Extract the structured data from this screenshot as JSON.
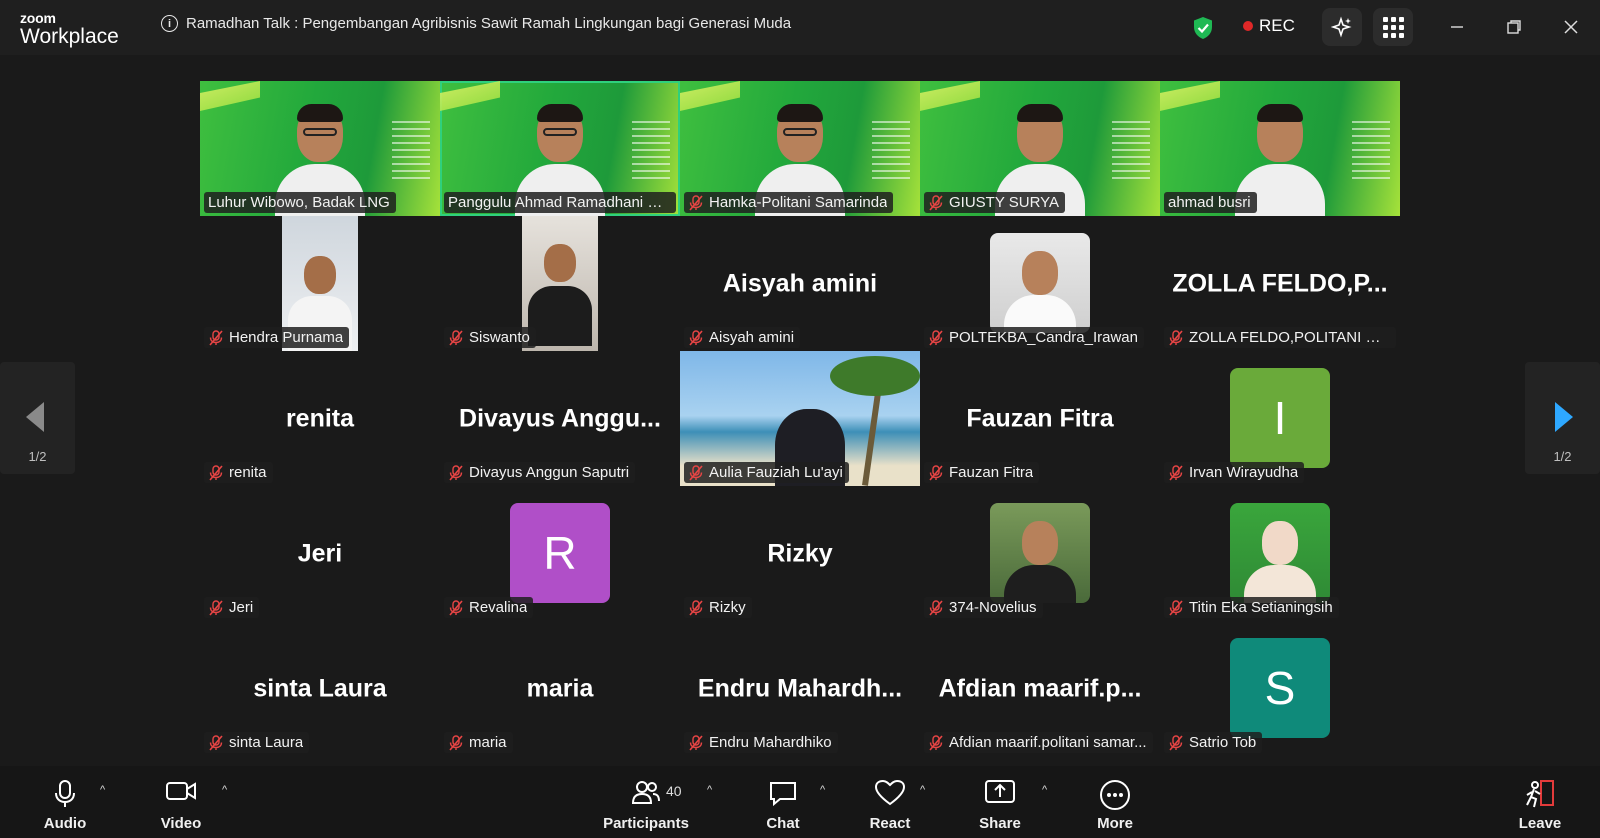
{
  "app": {
    "brand_top": "zoom",
    "brand_bottom": "Workplace"
  },
  "meeting": {
    "title": "Ramadhan Talk : Pengembangan Agribisnis Sawit Ramah Lingkungan bagi Generasi Muda",
    "rec_label": "REC"
  },
  "colors": {
    "active_speaker": "#2fd07d",
    "rec_dot": "#e02828",
    "security_shield": "#1fb954",
    "nav_arrow_right": "#2ea8ff"
  },
  "tiles": [
    {
      "name": "Luhur Wibowo, Badak LNG",
      "display": "",
      "kind": "video",
      "muted": false
    },
    {
      "name": "Panggulu Ahmad Ramadhani U...",
      "display": "",
      "kind": "video",
      "muted": false,
      "active": true
    },
    {
      "name": "Hamka-Politani Samarinda",
      "display": "",
      "kind": "video",
      "muted": true
    },
    {
      "name": "GIUSTY SURYA",
      "display": "",
      "kind": "video",
      "muted": true
    },
    {
      "name": "ahmad busri",
      "display": "",
      "kind": "video",
      "muted": false
    },
    {
      "name": "Hendra Purnama",
      "display": "",
      "kind": "photo-tall",
      "muted": true
    },
    {
      "name": "Siswanto",
      "display": "",
      "kind": "photo-tall",
      "muted": true
    },
    {
      "name": "Aisyah amini",
      "display": "Aisyah amini",
      "kind": "text",
      "muted": true
    },
    {
      "name": "POLTEKBA_Candra_Irawan",
      "display": "",
      "kind": "photo",
      "muted": true
    },
    {
      "name": "ZOLLA FELDO,POLITANI SA...",
      "display": "ZOLLA  FELDO,P...",
      "kind": "text",
      "muted": true
    },
    {
      "name": "renita",
      "display": "renita",
      "kind": "text",
      "muted": true
    },
    {
      "name": "Divayus Anggun Saputri",
      "display": "Divayus  Anggu...",
      "kind": "text",
      "muted": true
    },
    {
      "name": "Aulia Fauziah Lu'ayi",
      "display": "",
      "kind": "beach",
      "muted": true
    },
    {
      "name": "Fauzan Fitra",
      "display": "Fauzan Fitra",
      "kind": "text",
      "muted": true
    },
    {
      "name": "Irvan Wirayudha",
      "display": "I",
      "kind": "avatar",
      "avatar_color": "#6aaa3a",
      "muted": true
    },
    {
      "name": "Jeri",
      "display": "Jeri",
      "kind": "text",
      "muted": true
    },
    {
      "name": "Revalina",
      "display": "R",
      "kind": "avatar",
      "avatar_color": "#b04fc8",
      "muted": true
    },
    {
      "name": "Rizky",
      "display": "Rizky",
      "kind": "text",
      "muted": true
    },
    {
      "name": "374-Novelius",
      "display": "",
      "kind": "photo",
      "muted": true
    },
    {
      "name": "Titin Eka Setianingsih",
      "display": "",
      "kind": "photo",
      "muted": true
    },
    {
      "name": "sinta Laura",
      "display": "sinta Laura",
      "kind": "text",
      "muted": true
    },
    {
      "name": "maria",
      "display": "maria",
      "kind": "text",
      "muted": true
    },
    {
      "name": "Endru Mahardhiko",
      "display": "Endru  Mahardh...",
      "kind": "text",
      "muted": true
    },
    {
      "name": "Afdian maarif.politani samar...",
      "display": "Afdian  maarif.p...",
      "kind": "text",
      "muted": true
    },
    {
      "name": "Satrio Tob",
      "display": "S",
      "kind": "avatar",
      "avatar_color": "#0f8a7a",
      "muted": true
    }
  ],
  "pagination": {
    "left": "1/2",
    "right": "1/2"
  },
  "toolbar": {
    "audio": "Audio",
    "video": "Video",
    "participants": "Participants",
    "participants_count": "40",
    "chat": "Chat",
    "react": "React",
    "share": "Share",
    "more": "More",
    "leave": "Leave"
  }
}
